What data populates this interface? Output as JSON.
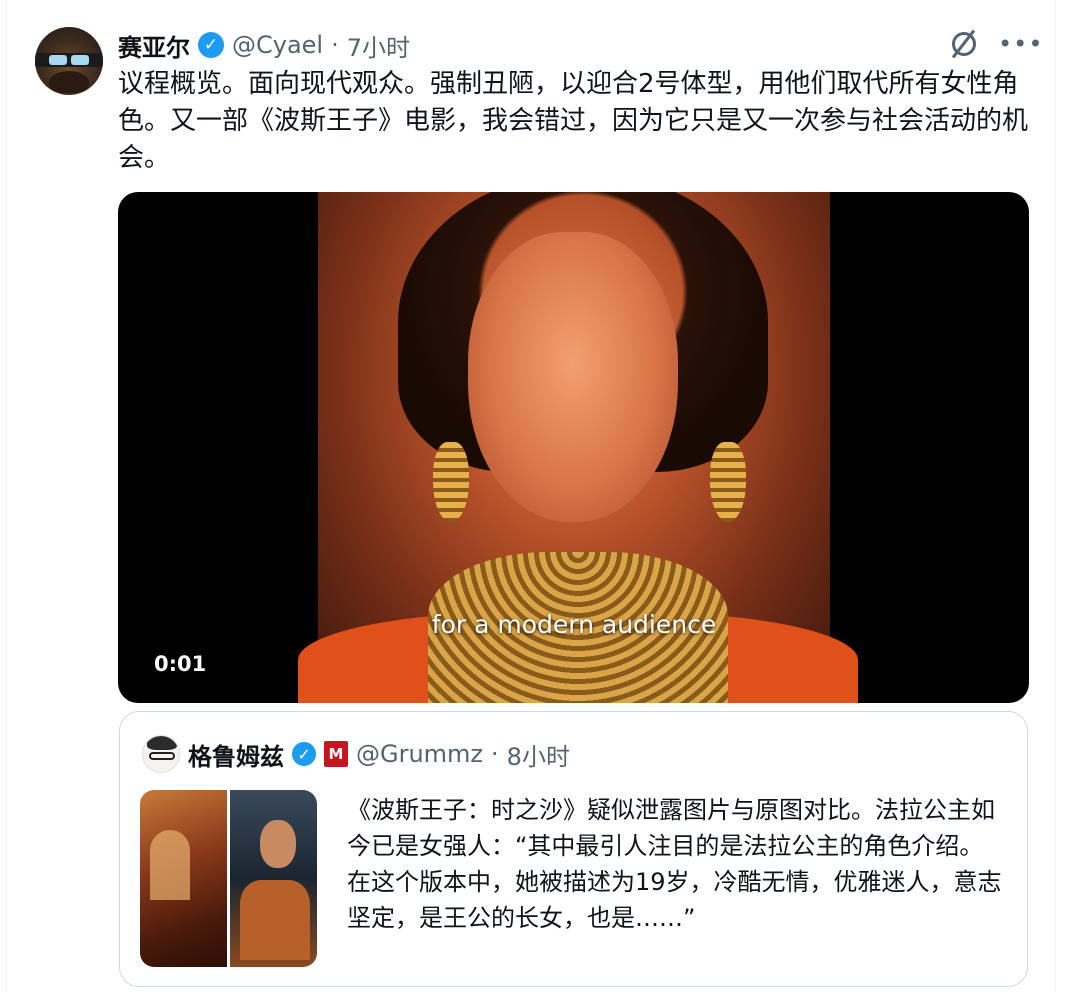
{
  "tweet": {
    "author_name": "赛亚尔",
    "verified_mark": "✓",
    "handle": "@Cyael",
    "separator": "·",
    "time": "7小时",
    "text": "议程概览。面向现代观众。强制丑陋，以迎合2号体型，用他们取代所有女性角色。又一部《波斯王子》电影，我会错过，因为它只是又一次参与社会活动的机会。",
    "more_icon": "•••",
    "video": {
      "caption": "for a modern audience",
      "timestamp": "0:01"
    }
  },
  "quote": {
    "author_name": "格鲁姆兹",
    "verified_mark": "✓",
    "badge_text": "M",
    "handle": "@Grummz",
    "separator": "·",
    "time": "8小时",
    "text": "《波斯王子：时之沙》疑似泄露图片与原图对比。法拉公主如今已是女强人：“其中最引人注目的是法拉公主的角色介绍。在这个版本中，她被描述为19岁，冷酷无情，优雅迷人，意志坚定，是王公的长女，也是……”"
  },
  "colors": {
    "accent": "#1d9bf0",
    "text_primary": "#0f1419",
    "text_secondary": "#536471",
    "border": "#cfd9de",
    "badge": "#c8141e"
  },
  "icons": {
    "verified": "verified-badge-icon",
    "grok": "grok-icon",
    "more": "more-icon"
  }
}
